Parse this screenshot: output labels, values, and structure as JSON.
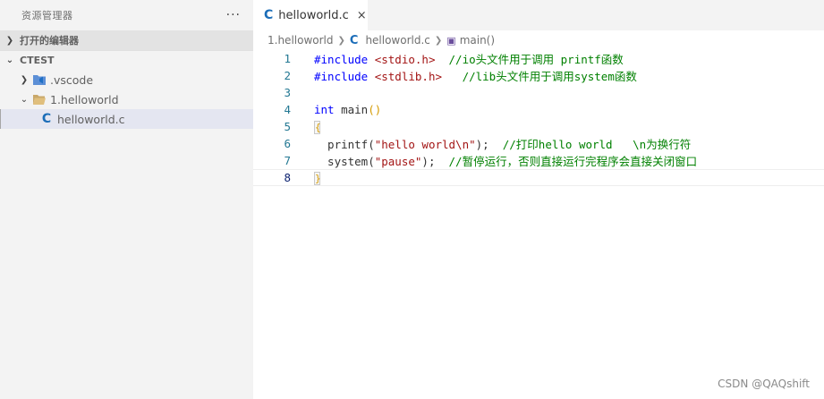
{
  "sidebar": {
    "title": "资源管理器",
    "more": "···",
    "open_editors": "打开的编辑器",
    "workspace": "CTEST",
    "tree": [
      {
        "label": ".vscode",
        "icon": "vscode-folder-icon"
      },
      {
        "label": "1.helloworld",
        "icon": "folder-open-icon"
      },
      {
        "label": "helloworld.c",
        "icon": "c-file-icon"
      }
    ]
  },
  "tabs": [
    {
      "label": "helloworld.c",
      "close": "×"
    }
  ],
  "breadcrumb": {
    "folder": "1.helloworld",
    "file": "helloworld.c",
    "symbol": "main()"
  },
  "editor": {
    "line_numbers": [
      "1",
      "2",
      "3",
      "4",
      "5",
      "6",
      "7",
      "8"
    ],
    "code": {
      "l1_directive": "#include ",
      "l1_header": "<stdio.h>",
      "l1_comment": "  //io头文件用于调用 printf函数",
      "l2_directive": "#include ",
      "l2_header": "<stdlib.h>",
      "l2_comment": "   //lib头文件用于调用system函数",
      "l4_kw": "int",
      "l4_fn": " main",
      "l4_paren": "()",
      "l5_brace": "{",
      "l6_fn": "  printf(",
      "l6_str": "\"hello world\\n\"",
      "l6_end": ");",
      "l6_comment": "  //打印hello world   \\n为换行符",
      "l7_fn": "  system(",
      "l7_str": "\"pause\"",
      "l7_end": ");",
      "l7_comment": "  //暂停运行，否则直接运行完程序会直接关闭窗口",
      "l8_brace": "}"
    }
  },
  "watermark": "CSDN @QAQshift",
  "colors": {
    "c_icon": "#1b6db8",
    "keyword": "#0000ff",
    "string": "#a31515",
    "comment": "#008000",
    "line_number": "#237893"
  }
}
